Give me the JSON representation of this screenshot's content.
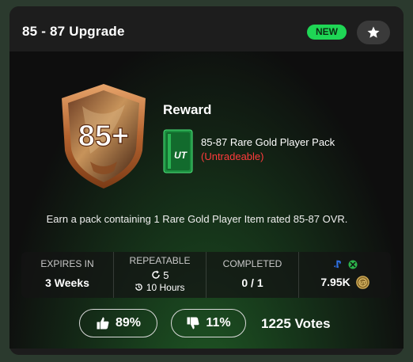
{
  "header": {
    "title": "85 - 87 Upgrade",
    "badge": "NEW",
    "favorite_icon": "star-icon"
  },
  "reward": {
    "badge_text": "85+",
    "label": "Reward",
    "pack_name": "85-87 Rare Gold Player Pack",
    "pack_status": "(Untradeable)",
    "pack_icon_text": "UT"
  },
  "description": "Earn a pack containing 1 Rare Gold Player Item rated 85-87 OVR.",
  "stats": {
    "expires_label": "EXPIRES IN",
    "expires_value": "3 Weeks",
    "repeatable_label": "REPEATABLE",
    "repeatable_count": "5",
    "repeatable_time": "10 Hours",
    "completed_label": "COMPLETED",
    "completed_value": "0 / 1",
    "platform_icons": [
      "playstation-icon",
      "xbox-icon"
    ],
    "cost_value": "7.95K",
    "coin_icon": "coin-icon"
  },
  "votes": {
    "up_percent": "89%",
    "down_percent": "11%",
    "total": "1225 Votes"
  },
  "colors": {
    "new_badge": "#1fd655",
    "untradeable": "#ff3b3b",
    "badge_bronze": "#b4632f"
  }
}
